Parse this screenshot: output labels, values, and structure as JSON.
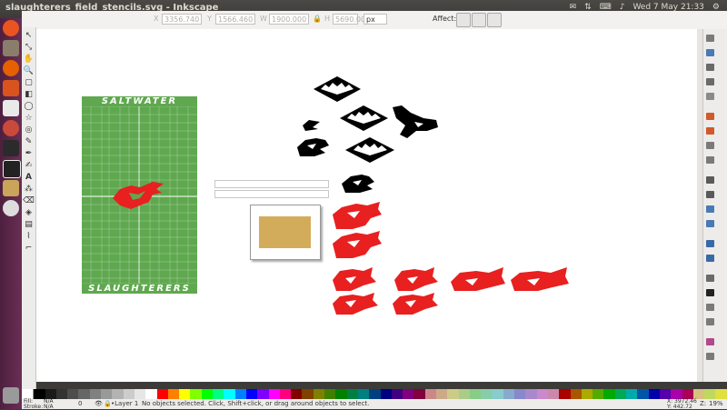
{
  "window": {
    "title": "slaughterers_field_stencils.svg - Inkscape",
    "clock": "Wed 7 May 21:33"
  },
  "controls": {
    "x_label": "X",
    "x_value": "3356.740",
    "y_label": "Y",
    "y_value": "1566.460",
    "w_label": "W",
    "w_value": "1900.000",
    "h_label": "H",
    "h_value": "5690.000",
    "unit": "px",
    "affect_label": "Affect:"
  },
  "field": {
    "top_text": "SALTWATER",
    "bottom_text": "SLAUGHTERERS",
    "turf_color": "#5fa84f",
    "line_color": "#ffffff"
  },
  "swatch": {
    "fill_color": "#d3ac5b"
  },
  "stencil_colors": {
    "black": "#000000",
    "red": "#e82020"
  },
  "status": {
    "fill_label": "Fill:",
    "fill_value": "N/A",
    "stroke_label": "Stroke:",
    "stroke_value": "N/A",
    "opacity_value": "0",
    "layer": "•Layer 1",
    "message": "No objects selected. Click, Shift+click, or drag around objects to select.",
    "x_readout": "X: 3972.46",
    "y_readout": "Y: 442.72",
    "zoom_label": "Z:",
    "zoom_value": "19%"
  }
}
